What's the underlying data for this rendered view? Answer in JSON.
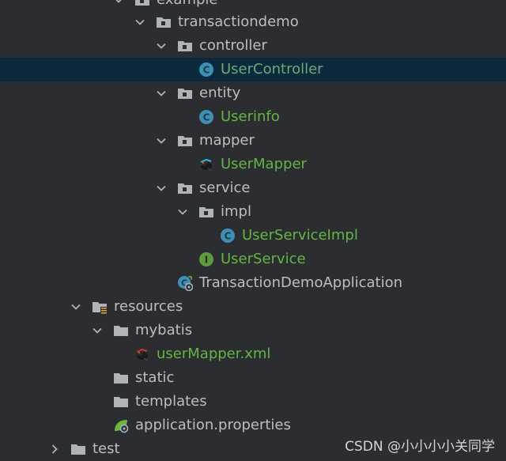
{
  "tree": {
    "nodes": [
      {
        "label": "example",
        "kind": "package",
        "expanded": true,
        "color": "default"
      },
      {
        "label": "transactiondemo",
        "kind": "package",
        "expanded": true,
        "color": "default"
      },
      {
        "label": "controller",
        "kind": "package",
        "expanded": true,
        "color": "default"
      },
      {
        "label": "UserController",
        "kind": "class",
        "selected": true,
        "color": "green"
      },
      {
        "label": "entity",
        "kind": "package",
        "expanded": true,
        "color": "default"
      },
      {
        "label": "Userinfo",
        "kind": "class",
        "color": "green"
      },
      {
        "label": "mapper",
        "kind": "package",
        "expanded": true,
        "color": "default"
      },
      {
        "label": "UserMapper",
        "kind": "mybatis-interface",
        "color": "green"
      },
      {
        "label": "service",
        "kind": "package",
        "expanded": true,
        "color": "default"
      },
      {
        "label": "impl",
        "kind": "package",
        "expanded": true,
        "color": "default"
      },
      {
        "label": "UserServiceImpl",
        "kind": "class",
        "color": "green"
      },
      {
        "label": "UserService",
        "kind": "interface",
        "color": "green"
      },
      {
        "label": "TransactionDemoApplication",
        "kind": "spring-boot-class",
        "color": "default"
      },
      {
        "label": "resources",
        "kind": "resources-folder",
        "expanded": true,
        "color": "default"
      },
      {
        "label": "mybatis",
        "kind": "folder",
        "expanded": true,
        "color": "default"
      },
      {
        "label": "userMapper.xml",
        "kind": "mybatis-xml",
        "color": "green"
      },
      {
        "label": "static",
        "kind": "folder",
        "color": "default"
      },
      {
        "label": "templates",
        "kind": "folder",
        "color": "default"
      },
      {
        "label": "application.properties",
        "kind": "spring-properties",
        "color": "default"
      },
      {
        "label": "test",
        "kind": "folder",
        "expanded": false,
        "color": "default"
      }
    ]
  },
  "watermark": {
    "text": "CSDN @小小小小关同学"
  },
  "colors": {
    "background": "#2b2d30",
    "selection": "#0d293e",
    "text": "#bcbec4",
    "vcs_added": "#62b543",
    "class_icon": "#3f8fb5",
    "interface_icon": "#5e9a3d"
  }
}
